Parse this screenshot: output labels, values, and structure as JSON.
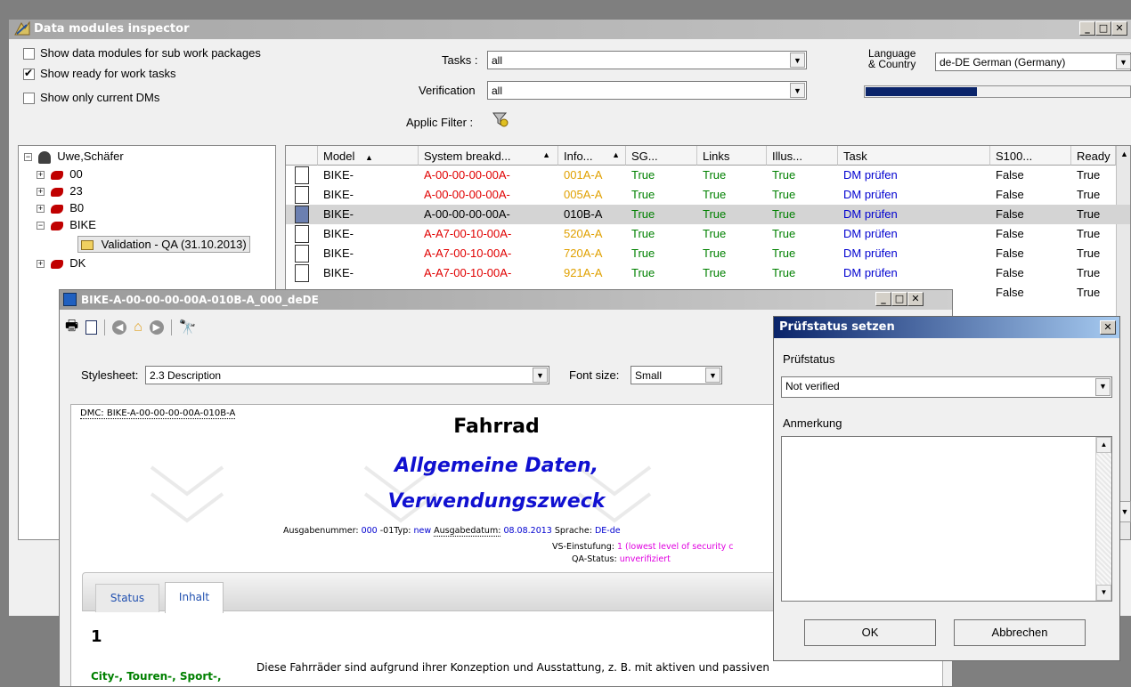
{
  "main_window": {
    "title": "Data modules inspector",
    "checkboxes": [
      {
        "label": "Show data modules for sub work packages",
        "checked": false
      },
      {
        "label": "Show ready for work tasks",
        "checked": true
      },
      {
        "label": "Show only current DMs",
        "checked": false
      }
    ],
    "tasks_label": "Tasks :",
    "tasks_value": "all",
    "verification_label": "Verification",
    "verification_value": "all",
    "applic_filter_label": "Applic Filter :",
    "language_label_1": "Language",
    "language_label_2": "& Country",
    "language_value": "de-DE German (Germany)",
    "progress": 0.42
  },
  "tree": {
    "root": "Uwe,Schäfer",
    "nodes": [
      "00",
      "23",
      "B0",
      "BIKE",
      "DK"
    ],
    "child": "Validation - QA (31.10.2013)"
  },
  "grid": {
    "columns": [
      "Model",
      "System breakd...",
      "Info...",
      "SG...",
      "Links",
      "Illus...",
      "Task",
      "S100...",
      "Ready"
    ],
    "rows": [
      {
        "model": "BIKE-",
        "system": "A-00-00-00-00A-",
        "info": "001A-A",
        "sg": "True",
        "links": "True",
        "illus": "True",
        "task": "DM prüfen",
        "s100": "False",
        "ready": "True",
        "sys_color": "red",
        "info_color": "orange",
        "selected": false
      },
      {
        "model": "BIKE-",
        "system": "A-00-00-00-00A-",
        "info": "005A-A",
        "sg": "True",
        "links": "True",
        "illus": "True",
        "task": "DM prüfen",
        "s100": "False",
        "ready": "True",
        "sys_color": "red",
        "info_color": "orange",
        "selected": false
      },
      {
        "model": "BIKE-",
        "system": "A-00-00-00-00A-",
        "info": "010B-A",
        "sg": "True",
        "links": "True",
        "illus": "True",
        "task": "DM prüfen",
        "s100": "False",
        "ready": "True",
        "sys_color": "black",
        "info_color": "black",
        "selected": true
      },
      {
        "model": "BIKE-",
        "system": "A-A7-00-10-00A-",
        "info": "520A-A",
        "sg": "True",
        "links": "True",
        "illus": "True",
        "task": "DM prüfen",
        "s100": "False",
        "ready": "True",
        "sys_color": "red",
        "info_color": "orange",
        "selected": false
      },
      {
        "model": "BIKE-",
        "system": "A-A7-00-10-00A-",
        "info": "720A-A",
        "sg": "True",
        "links": "True",
        "illus": "True",
        "task": "DM prüfen",
        "s100": "False",
        "ready": "True",
        "sys_color": "red",
        "info_color": "orange",
        "selected": false
      },
      {
        "model": "BIKE-",
        "system": "A-A7-00-10-00A-",
        "info": "921A-A",
        "sg": "True",
        "links": "True",
        "illus": "True",
        "task": "DM prüfen",
        "s100": "False",
        "ready": "True",
        "sys_color": "red",
        "info_color": "orange",
        "selected": false
      },
      {
        "s100": "False",
        "ready": "True"
      }
    ]
  },
  "viewer": {
    "title": "BIKE-A-00-00-00-00A-010B-A_000_deDE",
    "stylesheet_label": "Stylesheet:",
    "stylesheet_value": "2.3 Description",
    "fontsize_label": "Font size:",
    "fontsize_value": "Small",
    "dmc": "DMC: BIKE-A-00-00-00-00A-010B-A",
    "heading": "Fahrrad",
    "subheading_1": "Allgemeine Daten,",
    "subheading_2": "Verwendungszweck",
    "meta_issue_label": "Ausgabenummer:",
    "meta_issue_value": "000",
    "meta_inwork": "-01",
    "meta_type_label": "Typ:",
    "meta_type_value": "new",
    "meta_date_label": "Ausgabedatum:",
    "meta_date_value": "08.08.2013",
    "meta_lang_label": "Sprache:",
    "meta_lang_value": "DE-de",
    "security_label": "VS-Einstufung:",
    "security_value": "1 (lowest level of security c",
    "qa_label": "QA-Status:",
    "qa_value": "unverifiziert",
    "tabs": [
      "Status",
      "Inhalt"
    ],
    "section_number": "1",
    "side_label": "City-, Touren-, Sport-,",
    "body_text": "Diese Fahrräder sind aufgrund ihrer Konzeption und Ausstattung, z. B. mit aktiven und passiven"
  },
  "dialog": {
    "title": "Prüfstatus setzen",
    "status_label": "Prüfstatus",
    "status_value": "Not verified",
    "note_label": "Anmerkung",
    "ok_label": "OK",
    "cancel_label": "Abbrechen"
  }
}
